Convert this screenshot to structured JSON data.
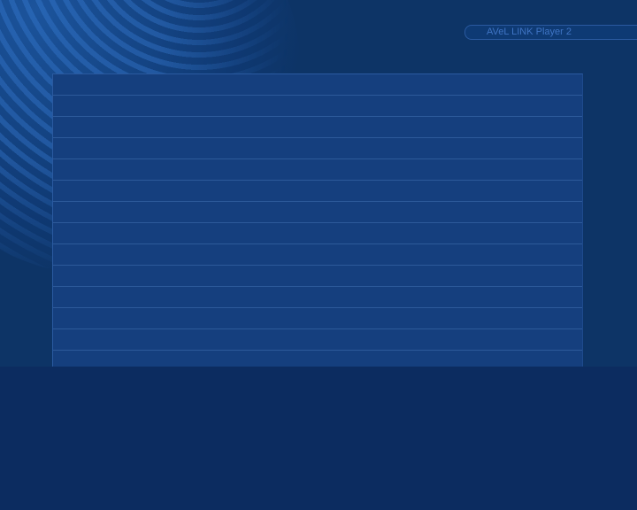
{
  "header": {
    "title": "AVeL LINK Player 2"
  },
  "list": {
    "rows": [
      "",
      "",
      "",
      "",
      "",
      "",
      "",
      "",
      "",
      "",
      "",
      "",
      "",
      ""
    ]
  },
  "colors": {
    "background": "#0d3466",
    "panel": "#153f7e",
    "bottom": "#0c2c60",
    "title_text": "#3f74c4"
  }
}
